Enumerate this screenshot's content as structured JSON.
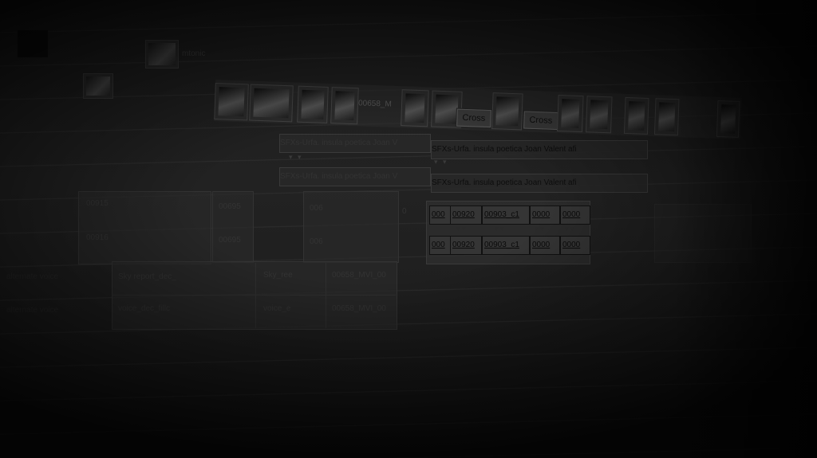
{
  "top_bar": {
    "label": "mtonic"
  },
  "video_track": {
    "clip_label": "00658_M",
    "transitions": [
      {
        "label": "Cross"
      },
      {
        "label": "Cross"
      }
    ]
  },
  "audio_tracks": [
    {
      "title": "SFXs-Urfa. insula poetica Joan V",
      "faded": true
    },
    {
      "title": "SFXs-Urfa. insula poetica Joan Valent afi",
      "faded": false
    },
    {
      "title": "SFXs-Urfa. insula poetica Joan V",
      "faded": true
    },
    {
      "title": "SFXs-Urfa. insula poetica Joan Valent afi",
      "faded": false
    }
  ],
  "track_headers": [
    {
      "name": "00915"
    },
    {
      "name": "00916"
    }
  ],
  "track_codes": [
    {
      "code": "00695"
    },
    {
      "code": "00695"
    }
  ],
  "track_short": [
    {
      "code": "006"
    },
    {
      "code": "006"
    }
  ],
  "row_marker": "0",
  "grid_rows": [
    {
      "cells": [
        "000",
        "00920",
        "00903_c1",
        "0000",
        "0000"
      ]
    },
    {
      "cells": [
        "000",
        "00920",
        "00903_c1",
        "0000",
        "0000"
      ]
    }
  ],
  "lower_rows": [
    {
      "left": "alternate voice",
      "name": "Sky report_dec_",
      "short": "Sky_ree",
      "clip": "00658_MVI_00"
    },
    {
      "left": "alternate voice",
      "name": "voice_dec_fillc",
      "short": "voice_e",
      "clip": "00658_MVI_00"
    }
  ]
}
